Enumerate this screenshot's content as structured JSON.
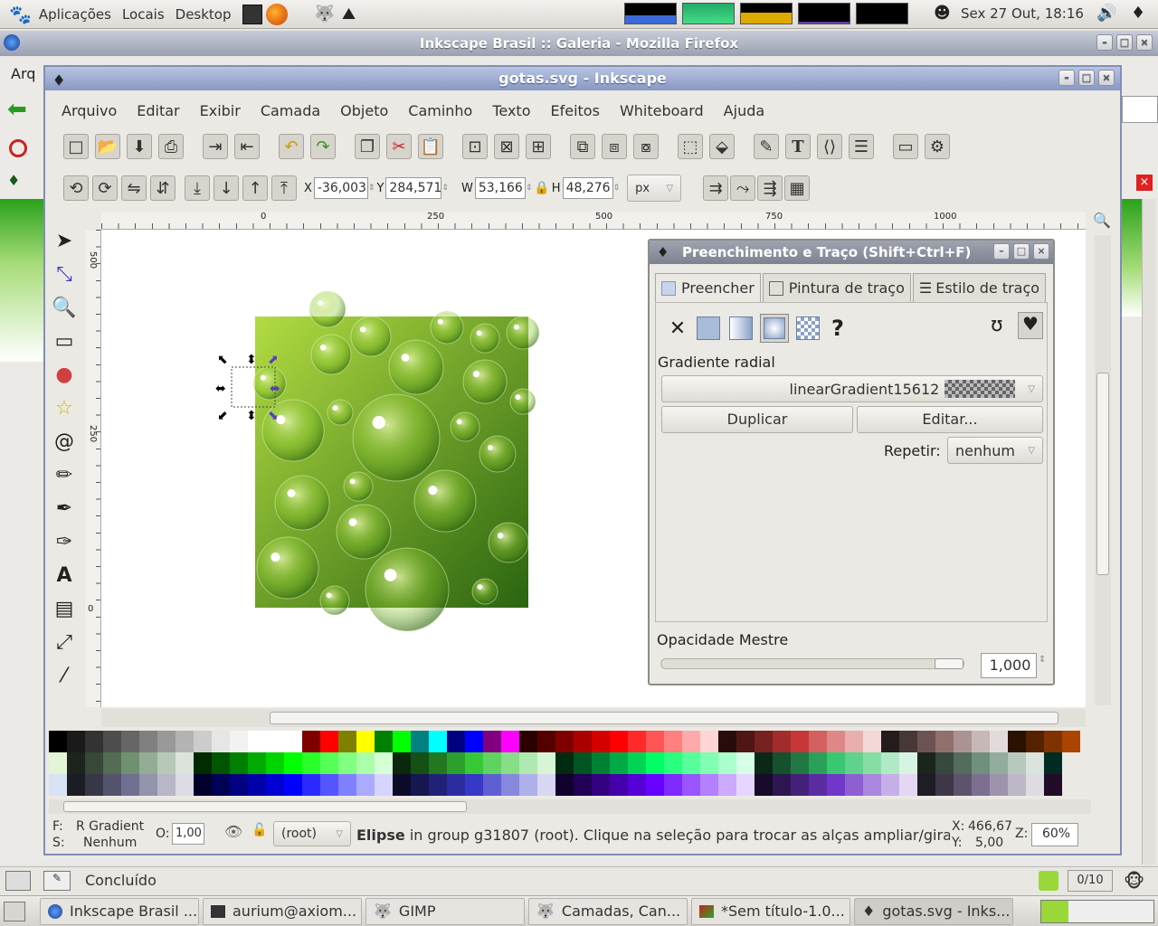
{
  "top_panel": {
    "menus": [
      "Aplicações",
      "Locais",
      "Desktop"
    ],
    "clock": "Sex 27 Out, 18:16"
  },
  "firefox": {
    "title": "Inkscape Brasil :: Galeria - Mozilla Firefox",
    "menu_partial": "Arq",
    "status": "Concluído",
    "page_counter": "0/10"
  },
  "inkscape": {
    "title": "gotas.svg - Inkscape",
    "menu": [
      "Arquivo",
      "Editar",
      "Exibir",
      "Camada",
      "Objeto",
      "Caminho",
      "Texto",
      "Efeitos",
      "Whiteboard",
      "Ajuda"
    ],
    "coords": {
      "x_label": "X",
      "x": "-36,003",
      "y_label": "Y",
      "y": "284,571",
      "w_label": "W",
      "w": "53,166",
      "h_label": "H",
      "h": "48,276",
      "unit": "px"
    },
    "ruler_ticks": [
      "0",
      "250",
      "500",
      "750",
      "1000"
    ],
    "vruler_labels": [
      "500",
      "250",
      "0"
    ],
    "status": {
      "fill_label": "F:",
      "fill_value": "R Gradient",
      "stroke_label": "S:",
      "stroke_value": "Nenhum",
      "opacity_label": "O:",
      "opacity_value": "1,00",
      "layer": "(root)",
      "message_bold": "Elipse",
      "message_rest": " in group g31807 (root). Clique na seleção para trocar as alças ampliar/gira",
      "cursor_x_label": "X:",
      "cursor_x": "466,67",
      "cursor_y_label": "Y:",
      "cursor_y": "5,00",
      "zoom_label": "Z:",
      "zoom": "60%"
    }
  },
  "dialog": {
    "title": "Preenchimento e Traço (Shift+Ctrl+F)",
    "tabs": [
      "Preencher",
      "Pintura de traço",
      "Estilo de traço"
    ],
    "gradient_type": "Gradiente radial",
    "gradient_name": "linearGradient15612",
    "duplicate_label": "Duplicar",
    "edit_label": "Editar...",
    "repeat_label": "Repetir:",
    "repeat_value": "nenhum",
    "master_opacity_label": "Opacidade Mestre",
    "master_opacity_value": "1,000"
  },
  "taskbar": {
    "items": [
      "Inkscape Brasil ...",
      "aurium@axiom...",
      "GIMP",
      "Camadas, Can...",
      "*Sem título-1.0...",
      "gotas.svg - Inks..."
    ]
  },
  "colors": {
    "accent_blue": "#8898c2",
    "canvas_green_light": "#b2dc42",
    "canvas_green_dark": "#2a6410"
  }
}
